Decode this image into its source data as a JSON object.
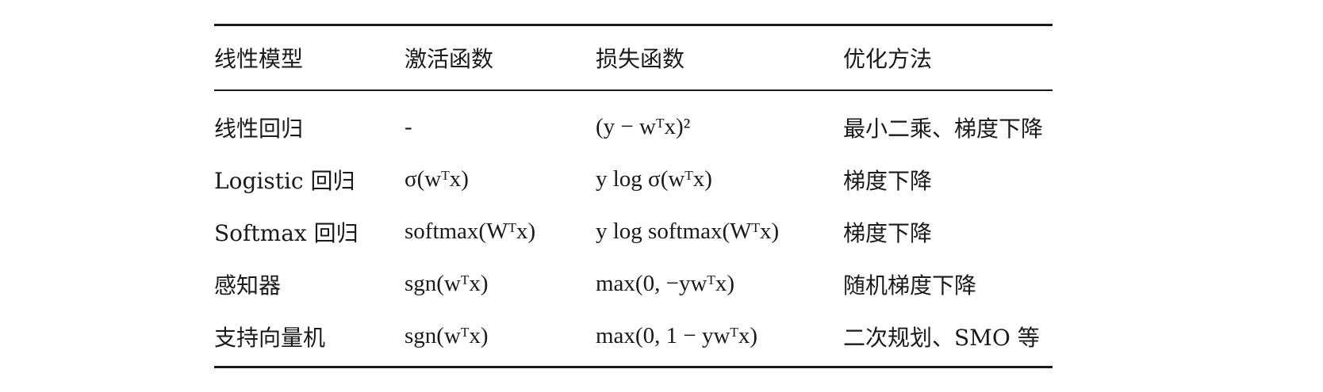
{
  "table": {
    "headers": [
      "线性模型",
      "激活函数",
      "损失函数",
      "优化方法"
    ],
    "rows": [
      [
        "线性回归",
        "-",
        "(y − wᵀx)²",
        "最小二乘、梯度下降"
      ],
      [
        "Logistic 回归",
        "σ(wᵀx)",
        "y log σ(wᵀx)",
        "梯度下降"
      ],
      [
        "Softmax 回归",
        "softmax(Wᵀx)",
        "y log softmax(Wᵀx)",
        "梯度下降"
      ],
      [
        "感知器",
        "sgn(wᵀx)",
        "max(0, −ywᵀx)",
        "随机梯度下降"
      ],
      [
        "支持向量机",
        "sgn(wᵀx)",
        "max(0, 1 − ywᵀx)",
        "二次规划、SMO 等"
      ]
    ]
  }
}
